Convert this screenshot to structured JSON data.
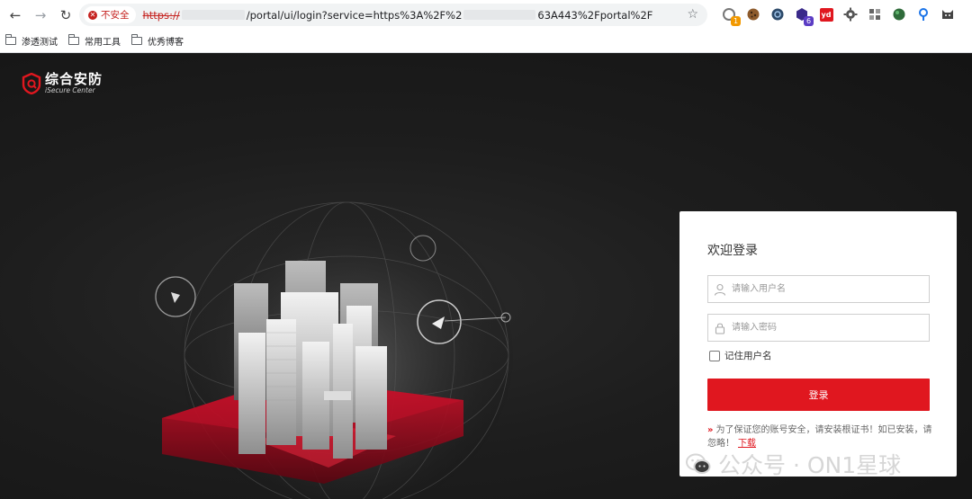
{
  "browser": {
    "security_label": "不安全",
    "url_scheme": "https://",
    "url_path": "/portal/ui/login?service=https%3A%2F%2",
    "url_tail": "63A443%2Fportal%2F",
    "extensions": [
      {
        "name": "ext-1",
        "badge": "1",
        "badge_color": "#f29900"
      },
      {
        "name": "ext-cookie",
        "badge": ""
      },
      {
        "name": "ext-blue-disc",
        "badge": ""
      },
      {
        "name": "ext-hex",
        "badge": "6",
        "badge_color": "#5b3cc4"
      },
      {
        "name": "ext-yd",
        "label": "yd",
        "badge": ""
      },
      {
        "name": "ext-gear",
        "badge": ""
      },
      {
        "name": "ext-grid",
        "badge": ""
      },
      {
        "name": "ext-green",
        "badge": ""
      },
      {
        "name": "ext-pin",
        "badge": ""
      },
      {
        "name": "ext-cat",
        "badge": ""
      }
    ]
  },
  "bookmarks": [
    "渗透测试",
    "常用工具",
    "优秀博客"
  ],
  "brand": {
    "title": "综合安防",
    "subtitle": "iSecure Center",
    "accent": "#e0171f"
  },
  "login": {
    "title": "欢迎登录",
    "username_placeholder": "请输入用户名",
    "password_placeholder": "请输入密码",
    "remember_label": "记住用户名",
    "submit_label": "登录",
    "notice_text": "为了保证您的账号安全，请安装根证书！如已安装，请忽略！",
    "download_label": "下载"
  },
  "watermark": {
    "text": "公众号 · ON1星球"
  }
}
